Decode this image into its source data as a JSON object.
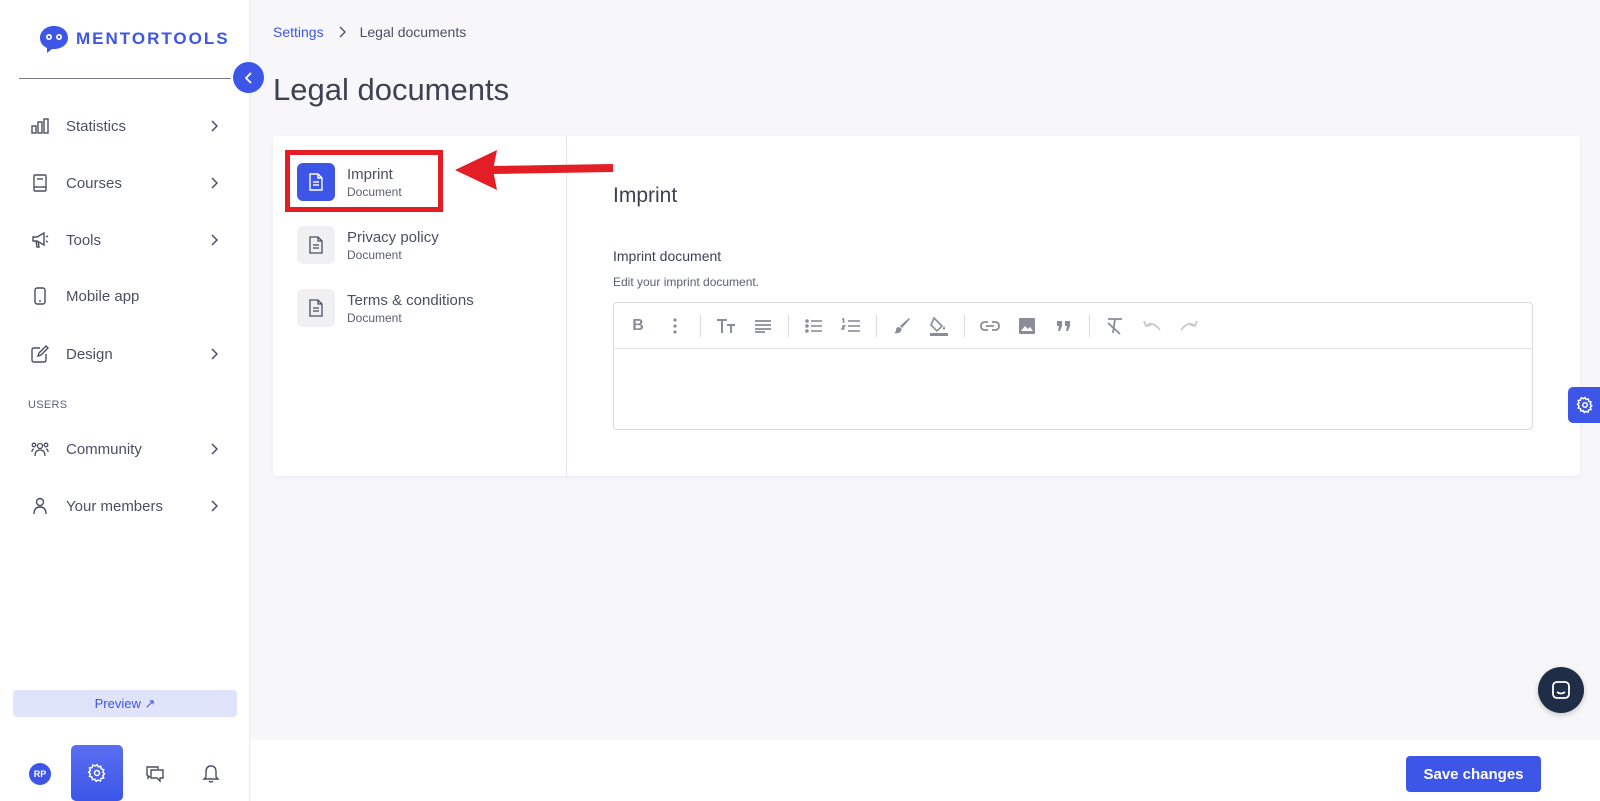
{
  "app": {
    "logo_text": "MENTORTOOLS"
  },
  "sidebar": {
    "items": [
      {
        "label": "Statistics",
        "icon": "bar-chart-icon",
        "has_chevron": true
      },
      {
        "label": "Courses",
        "icon": "book-icon",
        "has_chevron": true
      },
      {
        "label": "Tools",
        "icon": "megaphone-icon",
        "has_chevron": true
      },
      {
        "label": "Mobile app",
        "icon": "phone-icon",
        "has_chevron": false
      },
      {
        "label": "Design",
        "icon": "pencil-icon",
        "has_chevron": true
      }
    ],
    "users_section_label": "USERS",
    "user_items": [
      {
        "label": "Community",
        "icon": "users-icon",
        "has_chevron": true
      },
      {
        "label": "Your members",
        "icon": "user-icon",
        "has_chevron": true
      }
    ],
    "preview_label": "Preview ↗",
    "avatar_initials": "RP"
  },
  "breadcrumb": {
    "parent": "Settings",
    "current": "Legal documents"
  },
  "page": {
    "title": "Legal documents"
  },
  "documents": [
    {
      "title": "Imprint",
      "subtitle": "Document",
      "active": true
    },
    {
      "title": "Privacy policy",
      "subtitle": "Document",
      "active": false
    },
    {
      "title": "Terms & conditions",
      "subtitle": "Document",
      "active": false
    }
  ],
  "editor": {
    "section_title": "Imprint",
    "field_label": "Imprint document",
    "field_help": "Edit your imprint document.",
    "content": "",
    "toolbar_icons": [
      "bold-icon",
      "more-vertical-icon",
      "text-size-icon",
      "align-icon",
      "bullet-list-icon",
      "numbered-list-icon",
      "brush-icon",
      "fill-color-icon",
      "link-icon",
      "image-icon",
      "quote-icon",
      "clear-format-icon",
      "undo-icon",
      "redo-icon"
    ]
  },
  "footer": {
    "save_label": "Save changes"
  },
  "colors": {
    "accent": "#3d56e8",
    "annotation_red": "#e31e24"
  }
}
